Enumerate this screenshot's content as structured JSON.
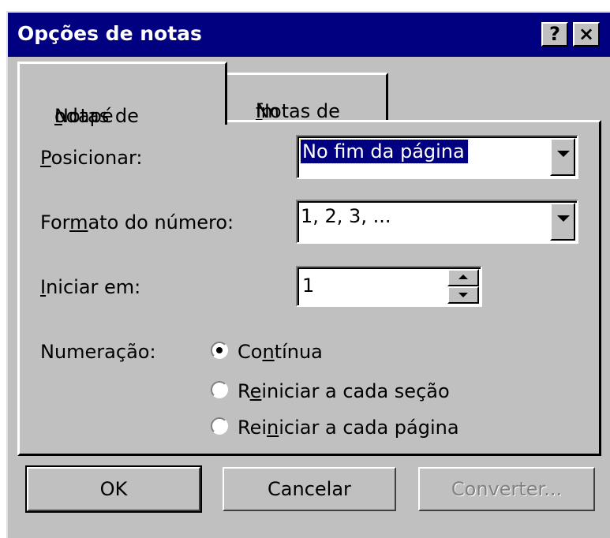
{
  "window": {
    "title": "Opções de notas",
    "help_label": "?",
    "close_label": "×"
  },
  "tabs": [
    {
      "label_pre": "Notas de ",
      "label_ul": "r",
      "label_post": "odapé",
      "selected": true
    },
    {
      "label_pre": "Notas de ",
      "label_ul": "f",
      "label_post": "im",
      "selected": false
    }
  ],
  "fields": {
    "position": {
      "label_ul": "P",
      "label_rest": "osicionar:",
      "value": "No fim da página"
    },
    "number_format": {
      "label_pre": "For",
      "label_ul": "m",
      "label_post": "ato do número:",
      "value": "1, 2, 3, ..."
    },
    "start_at": {
      "label_ul": "I",
      "label_rest": "niciar em:",
      "value": "1"
    }
  },
  "numbering": {
    "label": "Numeração:",
    "options": [
      {
        "pre": "Co",
        "ul": "n",
        "post": "tínua",
        "selected": true
      },
      {
        "pre": "R",
        "ul": "e",
        "post": "iniciar a cada seção",
        "selected": false
      },
      {
        "pre": "Rei",
        "ul": "n",
        "post": "iciar a cada página",
        "selected": false
      }
    ]
  },
  "buttons": {
    "ok": "OK",
    "cancel": "Cancelar",
    "convert": "Converter..."
  },
  "colors": {
    "titlebar": "#000080",
    "face": "#c0c0c0",
    "selection": "#000080"
  }
}
